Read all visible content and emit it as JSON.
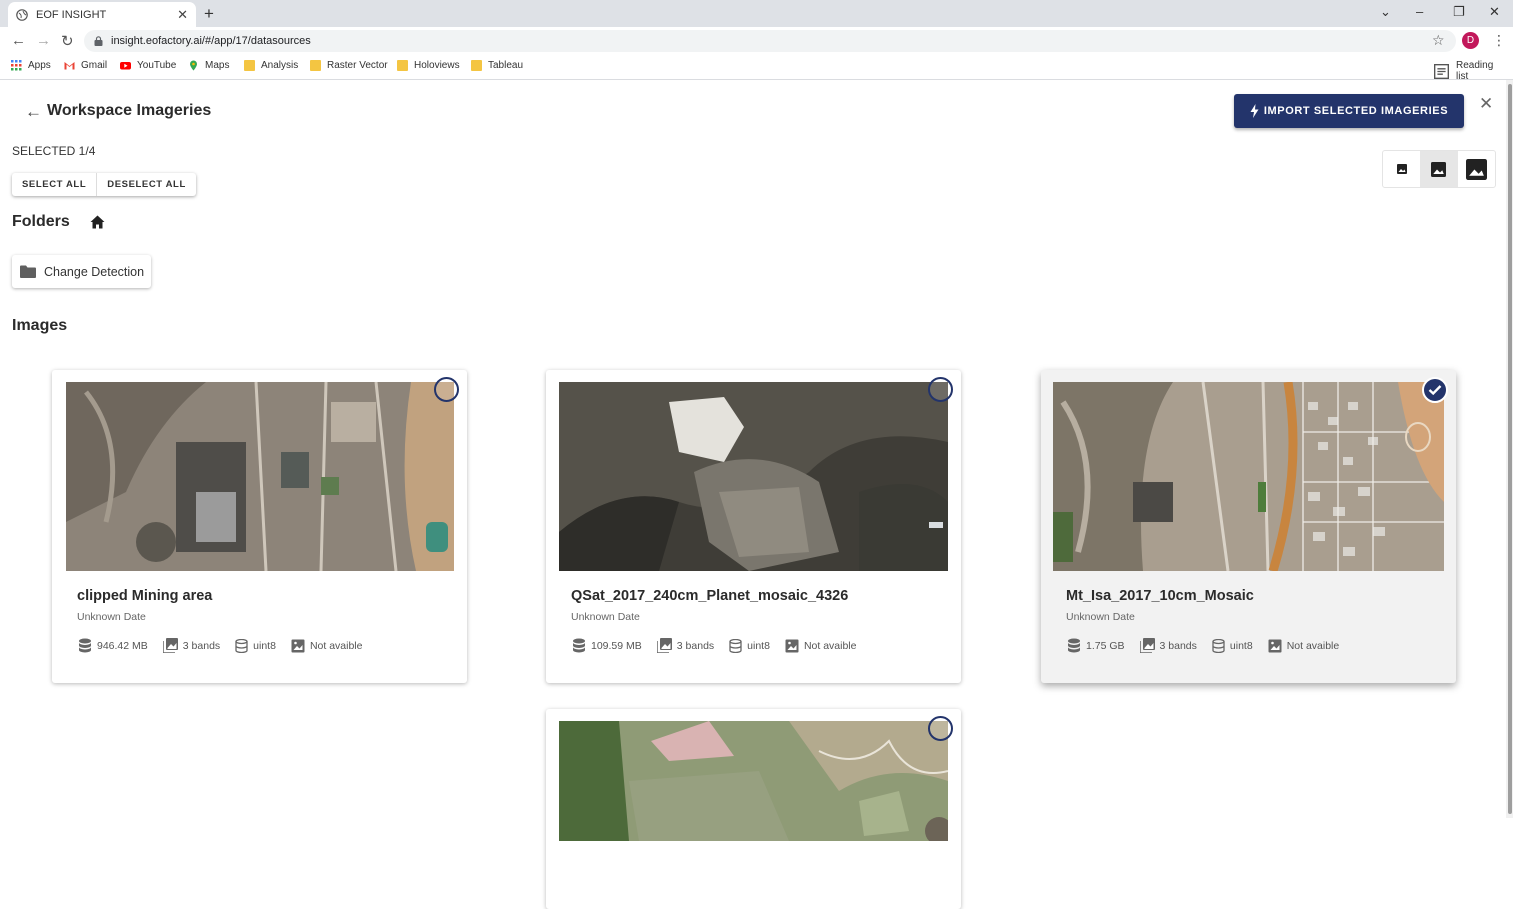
{
  "browser": {
    "tab_title": "EOF INSIGHT",
    "tab_close": "✕",
    "new_tab": "+",
    "url": "insight.eofactory.ai/#/app/17/datasources",
    "profile_initial": "D",
    "bookmarks": [
      {
        "label": "Apps",
        "icon": "apps-grid-icon"
      },
      {
        "label": "Gmail",
        "icon": "gmail-icon"
      },
      {
        "label": "YouTube",
        "icon": "youtube-icon"
      },
      {
        "label": "Maps",
        "icon": "maps-pin-icon"
      },
      {
        "label": "Analysis",
        "icon": "folder-icon"
      },
      {
        "label": "Raster Vector",
        "icon": "folder-icon"
      },
      {
        "label": "Holoviews",
        "icon": "folder-icon"
      },
      {
        "label": "Tableau",
        "icon": "folder-icon"
      }
    ],
    "reading_list": "Reading list"
  },
  "header": {
    "title": "Workspace Imageries",
    "import_label": "IMPORT SELECTED IMAGERIES"
  },
  "selection": {
    "count_text": "SELECTED 1/4",
    "select_all": "SELECT ALL",
    "deselect_all": "DESELECT ALL"
  },
  "folders": {
    "heading": "Folders",
    "items": [
      {
        "name": "Change Detection"
      }
    ]
  },
  "images": {
    "heading": "Images",
    "cards": [
      {
        "title": "clipped Mining area",
        "date": "Unknown Date",
        "size": "946.42 MB",
        "bands": "3 bands",
        "dtype": "uint8",
        "preview": "Not avaible",
        "selected": false
      },
      {
        "title": "QSat_2017_240cm_Planet_mosaic_4326",
        "date": "Unknown Date",
        "size": "109.59 MB",
        "bands": "3 bands",
        "dtype": "uint8",
        "preview": "Not avaible",
        "selected": false
      },
      {
        "title": "Mt_Isa_2017_10cm_Mosaic",
        "date": "Unknown Date",
        "size": "1.75 GB",
        "bands": "3 bands",
        "dtype": "uint8",
        "preview": "Not avaible",
        "selected": true
      },
      {
        "title": "",
        "date": "",
        "selected": false
      }
    ]
  },
  "colors": {
    "primary": "#23346b",
    "chrome_bg": "#dee1e6"
  }
}
